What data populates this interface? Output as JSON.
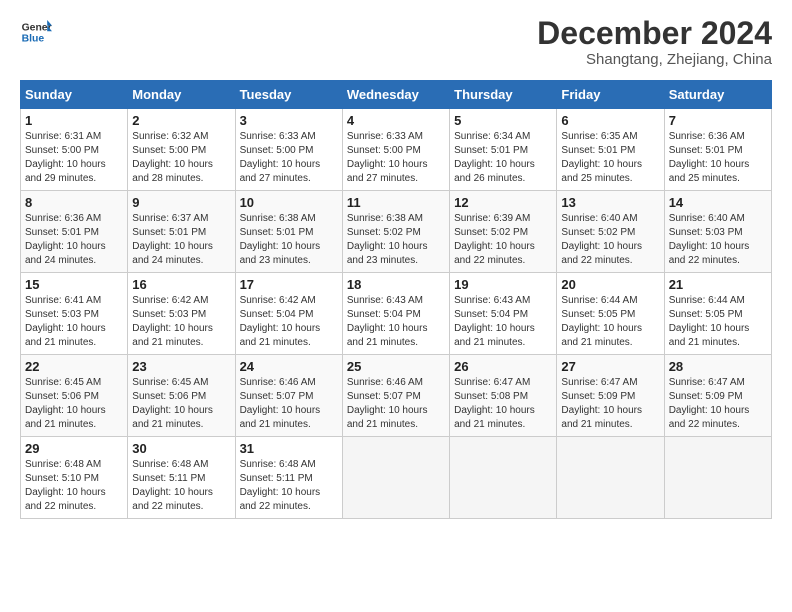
{
  "header": {
    "logo_line1": "General",
    "logo_line2": "Blue",
    "month": "December 2024",
    "location": "Shangtang, Zhejiang, China"
  },
  "weekdays": [
    "Sunday",
    "Monday",
    "Tuesday",
    "Wednesday",
    "Thursday",
    "Friday",
    "Saturday"
  ],
  "weeks": [
    [
      {
        "day": "1",
        "sunrise": "6:31 AM",
        "sunset": "5:00 PM",
        "daylight": "10 hours and 29 minutes."
      },
      {
        "day": "2",
        "sunrise": "6:32 AM",
        "sunset": "5:00 PM",
        "daylight": "10 hours and 28 minutes."
      },
      {
        "day": "3",
        "sunrise": "6:33 AM",
        "sunset": "5:00 PM",
        "daylight": "10 hours and 27 minutes."
      },
      {
        "day": "4",
        "sunrise": "6:33 AM",
        "sunset": "5:00 PM",
        "daylight": "10 hours and 27 minutes."
      },
      {
        "day": "5",
        "sunrise": "6:34 AM",
        "sunset": "5:01 PM",
        "daylight": "10 hours and 26 minutes."
      },
      {
        "day": "6",
        "sunrise": "6:35 AM",
        "sunset": "5:01 PM",
        "daylight": "10 hours and 25 minutes."
      },
      {
        "day": "7",
        "sunrise": "6:36 AM",
        "sunset": "5:01 PM",
        "daylight": "10 hours and 25 minutes."
      }
    ],
    [
      {
        "day": "8",
        "sunrise": "6:36 AM",
        "sunset": "5:01 PM",
        "daylight": "10 hours and 24 minutes."
      },
      {
        "day": "9",
        "sunrise": "6:37 AM",
        "sunset": "5:01 PM",
        "daylight": "10 hours and 24 minutes."
      },
      {
        "day": "10",
        "sunrise": "6:38 AM",
        "sunset": "5:01 PM",
        "daylight": "10 hours and 23 minutes."
      },
      {
        "day": "11",
        "sunrise": "6:38 AM",
        "sunset": "5:02 PM",
        "daylight": "10 hours and 23 minutes."
      },
      {
        "day": "12",
        "sunrise": "6:39 AM",
        "sunset": "5:02 PM",
        "daylight": "10 hours and 22 minutes."
      },
      {
        "day": "13",
        "sunrise": "6:40 AM",
        "sunset": "5:02 PM",
        "daylight": "10 hours and 22 minutes."
      },
      {
        "day": "14",
        "sunrise": "6:40 AM",
        "sunset": "5:03 PM",
        "daylight": "10 hours and 22 minutes."
      }
    ],
    [
      {
        "day": "15",
        "sunrise": "6:41 AM",
        "sunset": "5:03 PM",
        "daylight": "10 hours and 21 minutes."
      },
      {
        "day": "16",
        "sunrise": "6:42 AM",
        "sunset": "5:03 PM",
        "daylight": "10 hours and 21 minutes."
      },
      {
        "day": "17",
        "sunrise": "6:42 AM",
        "sunset": "5:04 PM",
        "daylight": "10 hours and 21 minutes."
      },
      {
        "day": "18",
        "sunrise": "6:43 AM",
        "sunset": "5:04 PM",
        "daylight": "10 hours and 21 minutes."
      },
      {
        "day": "19",
        "sunrise": "6:43 AM",
        "sunset": "5:04 PM",
        "daylight": "10 hours and 21 minutes."
      },
      {
        "day": "20",
        "sunrise": "6:44 AM",
        "sunset": "5:05 PM",
        "daylight": "10 hours and 21 minutes."
      },
      {
        "day": "21",
        "sunrise": "6:44 AM",
        "sunset": "5:05 PM",
        "daylight": "10 hours and 21 minutes."
      }
    ],
    [
      {
        "day": "22",
        "sunrise": "6:45 AM",
        "sunset": "5:06 PM",
        "daylight": "10 hours and 21 minutes."
      },
      {
        "day": "23",
        "sunrise": "6:45 AM",
        "sunset": "5:06 PM",
        "daylight": "10 hours and 21 minutes."
      },
      {
        "day": "24",
        "sunrise": "6:46 AM",
        "sunset": "5:07 PM",
        "daylight": "10 hours and 21 minutes."
      },
      {
        "day": "25",
        "sunrise": "6:46 AM",
        "sunset": "5:07 PM",
        "daylight": "10 hours and 21 minutes."
      },
      {
        "day": "26",
        "sunrise": "6:47 AM",
        "sunset": "5:08 PM",
        "daylight": "10 hours and 21 minutes."
      },
      {
        "day": "27",
        "sunrise": "6:47 AM",
        "sunset": "5:09 PM",
        "daylight": "10 hours and 21 minutes."
      },
      {
        "day": "28",
        "sunrise": "6:47 AM",
        "sunset": "5:09 PM",
        "daylight": "10 hours and 22 minutes."
      }
    ],
    [
      {
        "day": "29",
        "sunrise": "6:48 AM",
        "sunset": "5:10 PM",
        "daylight": "10 hours and 22 minutes."
      },
      {
        "day": "30",
        "sunrise": "6:48 AM",
        "sunset": "5:11 PM",
        "daylight": "10 hours and 22 minutes."
      },
      {
        "day": "31",
        "sunrise": "6:48 AM",
        "sunset": "5:11 PM",
        "daylight": "10 hours and 22 minutes."
      },
      null,
      null,
      null,
      null
    ]
  ],
  "labels": {
    "sunrise": "Sunrise:",
    "sunset": "Sunset:",
    "daylight": "Daylight:"
  }
}
